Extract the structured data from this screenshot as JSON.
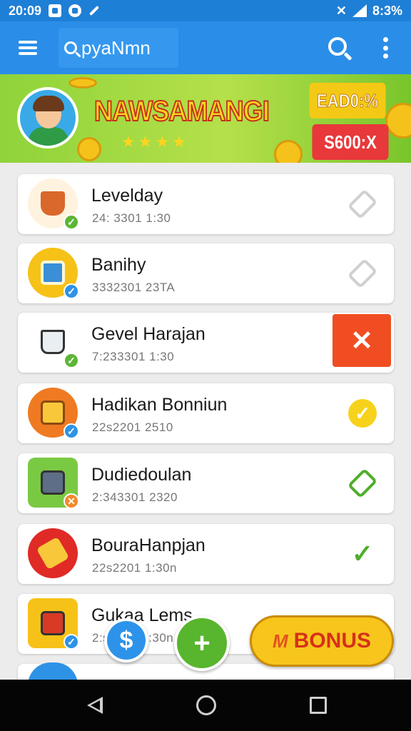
{
  "status_bar": {
    "time": "20:09",
    "battery": "8:3%",
    "icons": [
      "notification-icon",
      "alarm-icon",
      "edit-icon",
      "mute-icon",
      "signal-icon"
    ]
  },
  "app_bar": {
    "search_value": "pyaNmn",
    "icons": [
      "menu-icon",
      "search-icon",
      "overflow-icon"
    ]
  },
  "banner": {
    "title": "NAWSAMANGI",
    "stars": "★★★★",
    "tags": [
      "EAD0:%",
      "S600:X"
    ]
  },
  "list": {
    "items": [
      {
        "title": "Levelday",
        "subtitle": "24: 3301 1:30",
        "action": "tag-icon",
        "badge": "✓"
      },
      {
        "title": "Banihy",
        "subtitle": "3332301 23TA",
        "action": "link-icon",
        "badge": "✓"
      },
      {
        "title": "Gevel Harajan",
        "subtitle": "7:233301 1:30",
        "action": "close-button",
        "action_label": "✕",
        "badge": "✓"
      },
      {
        "title": "Hadikan Bonniun",
        "subtitle": "22s2201 2510",
        "action": "check-icon",
        "action_label": "✓",
        "badge": "✓"
      },
      {
        "title": "Dudiedoulan",
        "subtitle": "2:343301 2320",
        "action": "tag-icon",
        "badge": "✕"
      },
      {
        "title": "BouraHanpjan",
        "subtitle": "22s2201 1:30n",
        "action": "check-icon",
        "action_label": "✓",
        "badge": ""
      },
      {
        "title": "Gukaa Lems",
        "subtitle": "2:s2201 1:30n",
        "action": "",
        "badge": "✓"
      }
    ]
  },
  "fabs": {
    "money_label": "$",
    "add_label": "+",
    "bonus_mark": "M",
    "bonus_label": "BONUS"
  },
  "colors": {
    "status_bar": "#1e7fd6",
    "app_bar": "#2a8ee8",
    "close_red": "#f04e22",
    "check_yellow": "#f7d21c",
    "check_green": "#4fae2a",
    "bonus_yellow": "#f8c51c"
  }
}
